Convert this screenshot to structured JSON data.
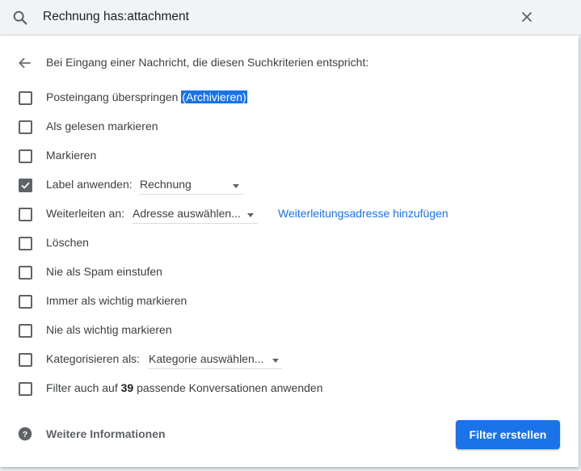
{
  "search": {
    "query": "Rechnung has:attachment"
  },
  "panel": {
    "heading": "Bei Eingang einer Nachricht, die diesen Suchkriterien entspricht:",
    "options": {
      "skip_inbox": {
        "label": "Posteingang überspringen",
        "highlight": "(Archivieren)",
        "checked": false
      },
      "mark_read": {
        "label": "Als gelesen markieren",
        "checked": false
      },
      "star": {
        "label": "Markieren",
        "checked": false
      },
      "apply_label": {
        "label": "Label anwenden:",
        "select_value": "Rechnung",
        "checked": true
      },
      "forward": {
        "label": "Weiterleiten an:",
        "select_value": "Adresse auswählen...",
        "link": "Weiterleitungsadresse hinzufügen",
        "checked": false
      },
      "delete": {
        "label": "Löschen",
        "checked": false
      },
      "never_spam": {
        "label": "Nie als Spam einstufen",
        "checked": false
      },
      "always_important": {
        "label": "Immer als wichtig markieren",
        "checked": false
      },
      "never_important": {
        "label": "Nie als wichtig markieren",
        "checked": false
      },
      "categorize": {
        "label": "Kategorisieren als:",
        "select_value": "Kategorie auswählen...",
        "checked": false
      },
      "apply_existing": {
        "label_before": "Filter auch auf ",
        "count": "39",
        "label_after": " passende Konversationen anwenden",
        "checked": false
      }
    },
    "footer": {
      "more_info": "Weitere Informationen",
      "create_button": "Filter erstellen"
    }
  },
  "colors": {
    "accent": "#1a73e8",
    "checkbox": "#5f6368",
    "text": "#3c4043"
  }
}
